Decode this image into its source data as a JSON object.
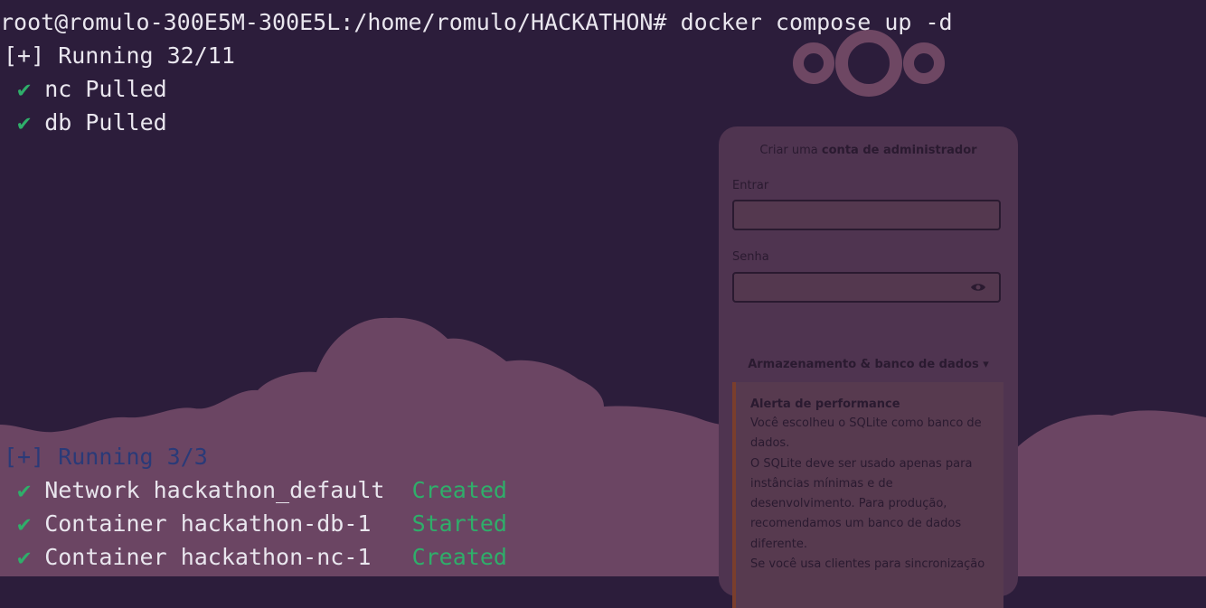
{
  "terminal": {
    "prompt": "root@romulo-300E5M-300E5L:/home/romulo/HACKATHON#",
    "command": "docker compose up -d",
    "running1": "[+] Running 32/11",
    "pulled": [
      {
        "check": "✔",
        "name": "nc",
        "status": "Pulled"
      },
      {
        "check": "✔",
        "name": "db",
        "status": "Pulled"
      }
    ],
    "running2": "[+] Running 3/3",
    "resources": [
      {
        "check": "✔",
        "name": "Network hackathon_default",
        "status": "Created"
      },
      {
        "check": "✔",
        "name": "Container hackathon-db-1",
        "status": "Started"
      },
      {
        "check": "✔",
        "name": "Container hackathon-nc-1",
        "status": "Created"
      }
    ]
  },
  "setup": {
    "title_prefix": "Criar uma",
    "title_bold": "conta de administrador",
    "user_label": "Entrar",
    "password_label": "Senha",
    "storage_label": "Armazenamento & banco de dados ▾",
    "alert_title": "Alerta de performance",
    "alert_lines": [
      "Você escolheu o SQLite como banco de",
      "dados.",
      "O SQLite deve ser usado apenas para",
      "instâncias mínimas e de",
      "desenvolvimento. Para produção,",
      "recomendamos um banco de dados",
      "diferente.",
      "Se você usa clientes para sincronização"
    ]
  },
  "colors": {
    "background": "#2c1d3b",
    "terminal_text": "#e9e6ee",
    "success": "#2fae6a",
    "cloud": "#6e4763"
  }
}
